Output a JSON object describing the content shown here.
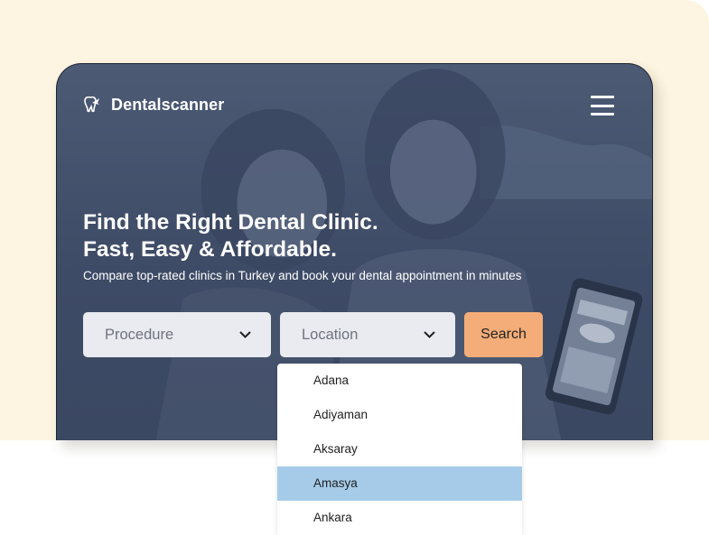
{
  "brand": {
    "name": "Dentalscanner",
    "icon": "tooth-plane-icon"
  },
  "menu": {
    "icon": "hamburger-menu-icon"
  },
  "hero": {
    "headline_line1": "Find the Right Dental Clinic.",
    "headline_line2": "Fast, Easy & Affordable.",
    "subheadline": "Compare top-rated clinics in Turkey and book your dental appointment in minutes"
  },
  "search": {
    "procedure_placeholder": "Procedure",
    "location_placeholder": "Location",
    "button_label": "Search"
  },
  "location_dropdown": {
    "options": [
      "Adana",
      "Adiyaman",
      "Aksaray",
      "Amasya",
      "Ankara"
    ],
    "highlighted": "Amasya"
  },
  "colors": {
    "page_background": "#fdf4e1",
    "hero_overlay": "#44526c",
    "search_button": "#f4ad78",
    "select_background": "#e9ebf0",
    "highlight": "#a5cbe8"
  }
}
